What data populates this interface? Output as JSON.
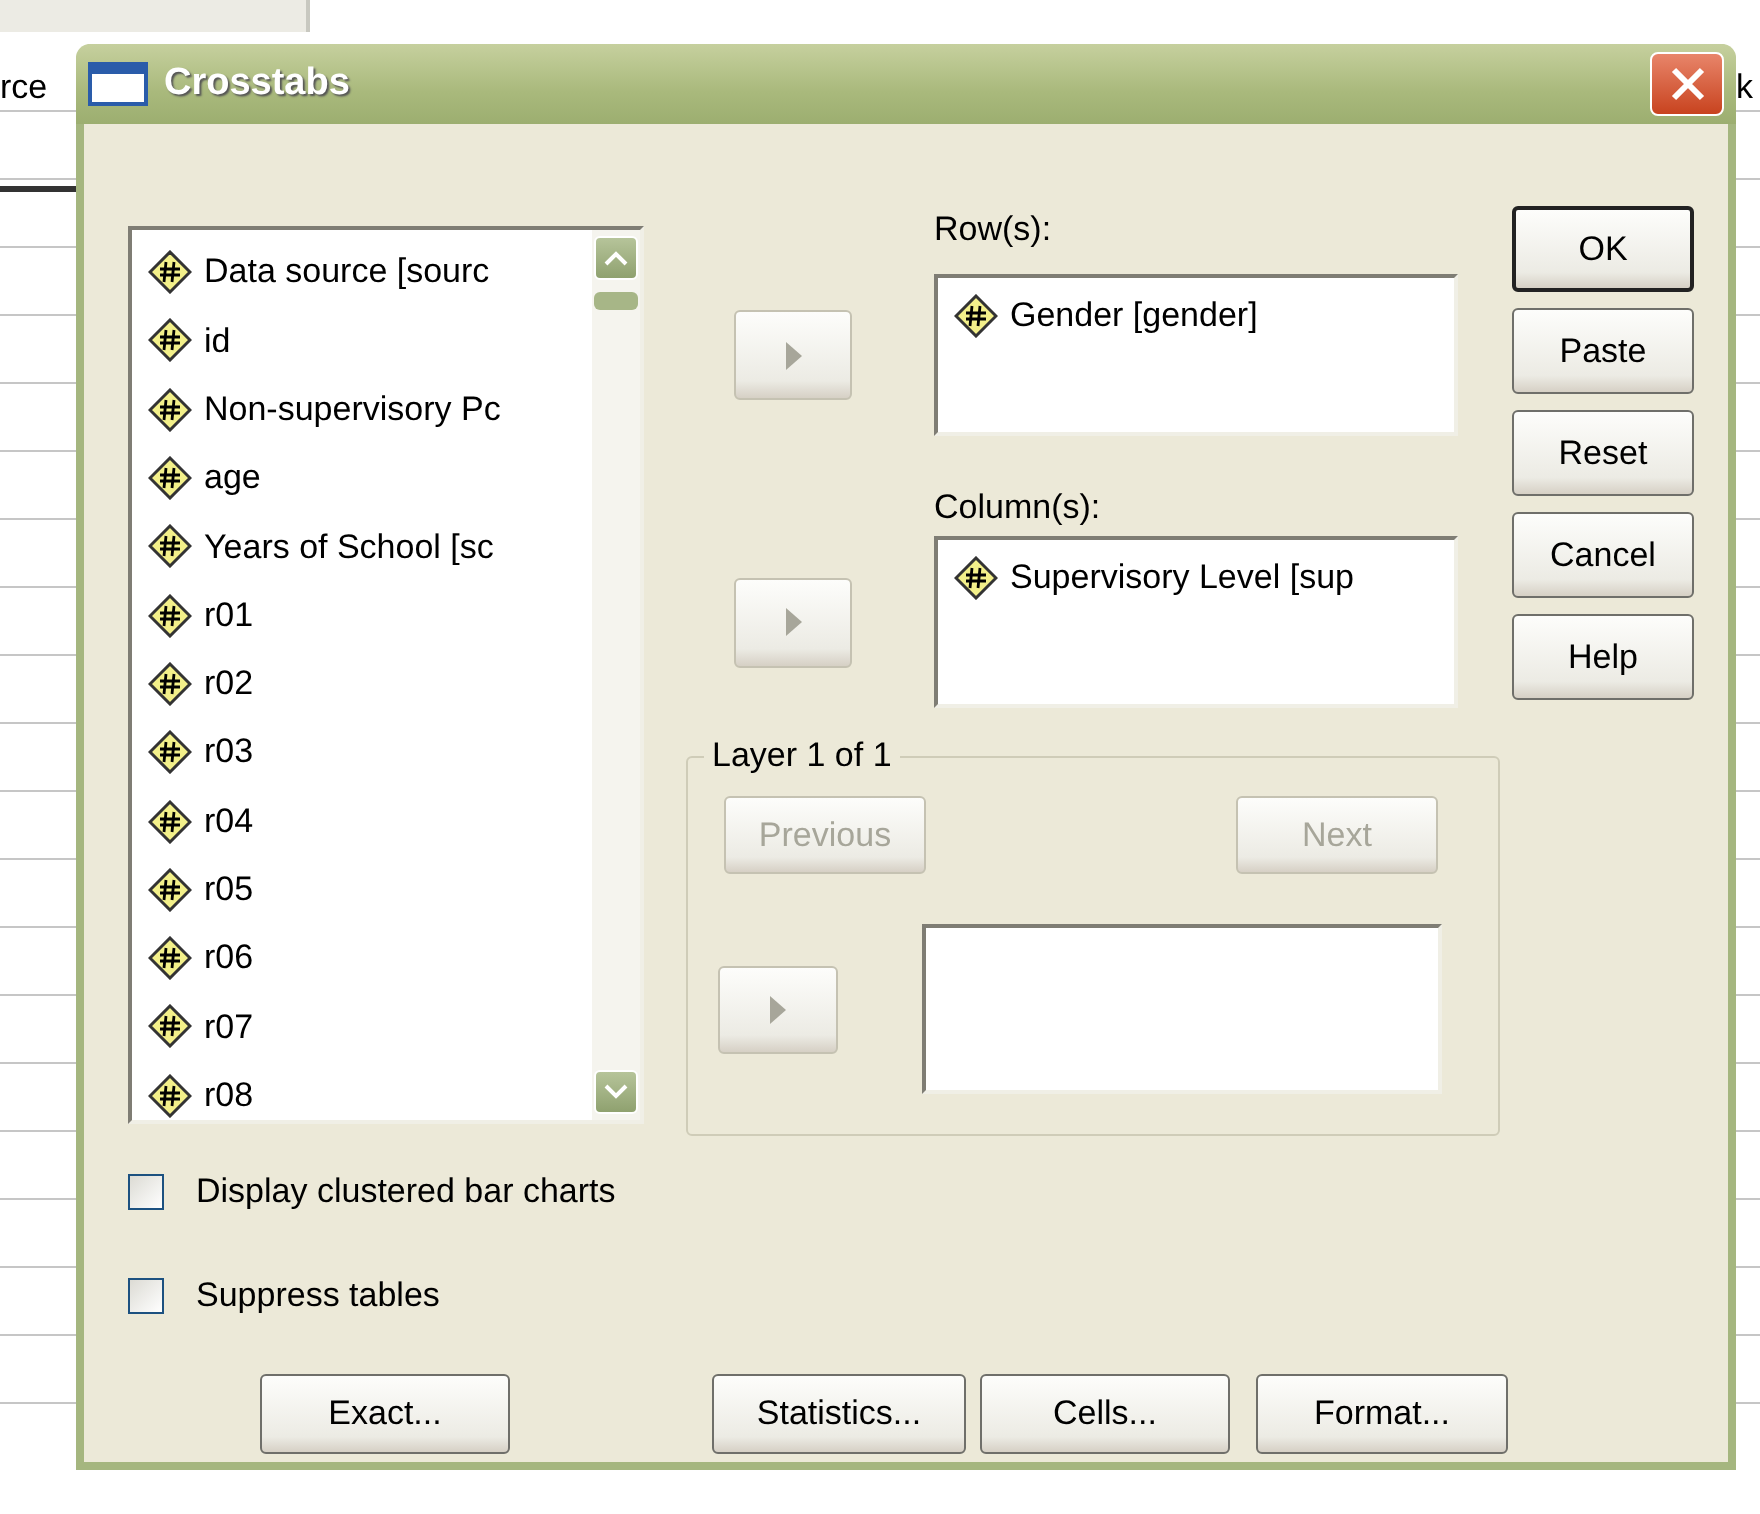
{
  "window": {
    "title": "Crosstabs"
  },
  "background": {
    "left_text": "rce",
    "right_text": "k"
  },
  "variables": [
    {
      "label": "Data source [sourc"
    },
    {
      "label": "id"
    },
    {
      "label": "Non-supervisory Pc"
    },
    {
      "label": "age"
    },
    {
      "label": "Years of School [sc"
    },
    {
      "label": "r01"
    },
    {
      "label": "r02"
    },
    {
      "label": "r03"
    },
    {
      "label": "r04"
    },
    {
      "label": "r05"
    },
    {
      "label": "r06"
    },
    {
      "label": "r07"
    },
    {
      "label": "r08"
    }
  ],
  "rows": {
    "label": "Row(s):",
    "items": [
      "Gender [gender]"
    ],
    "arrow_disabled": true
  },
  "columns": {
    "label": "Column(s):",
    "items": [
      "Supervisory Level [sup"
    ],
    "arrow_disabled": true
  },
  "layer": {
    "title": "Layer 1 of 1",
    "previous": {
      "label": "Previous",
      "disabled": true
    },
    "next": {
      "label": "Next",
      "disabled": true
    },
    "arrow_disabled": true
  },
  "side_buttons": [
    {
      "label": "OK",
      "default": true
    },
    {
      "label": "Paste",
      "default": false
    },
    {
      "label": "Reset",
      "default": false
    },
    {
      "label": "Cancel",
      "default": false
    },
    {
      "label": "Help",
      "default": false
    }
  ],
  "options": [
    {
      "label": "Display clustered bar charts",
      "checked": false
    },
    {
      "label": "Suppress tables",
      "checked": false
    }
  ],
  "bottom_buttons": [
    "Exact...",
    "Statistics...",
    "Cells...",
    "Format..."
  ]
}
